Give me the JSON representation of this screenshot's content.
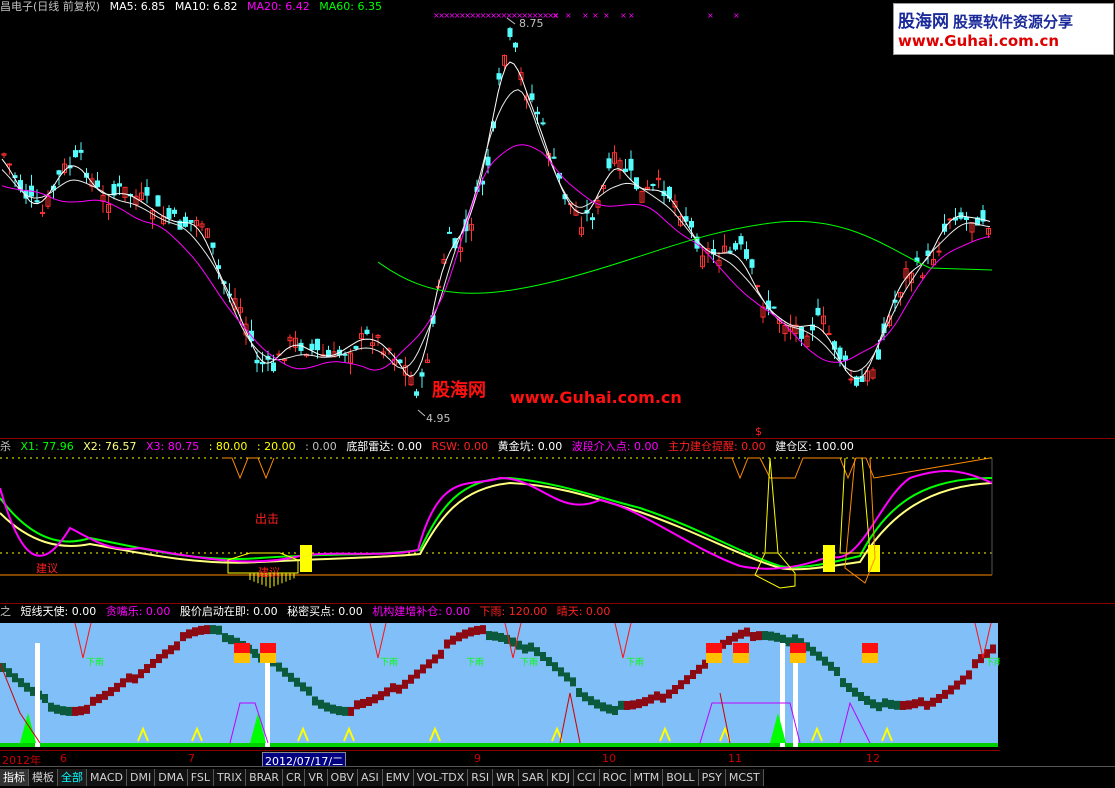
{
  "main_panel": {
    "title": "昌电子(日线 前复权)",
    "ma_items": [
      {
        "label": "MA5: 6.85",
        "color": "#ffffff"
      },
      {
        "label": "MA10: 6.82",
        "color": "#ffffff"
      },
      {
        "label": "MA20: 6.42",
        "color": "#ff00ff"
      },
      {
        "label": "MA60: 6.35",
        "color": "#00ff00"
      }
    ],
    "high_label": "8.75",
    "low_label": "4.95",
    "watermark1": "股海网",
    "watermark2": "www.Guhai.com.cn"
  },
  "logo": {
    "line1a": "股海网",
    "line1b": "股票软件资源分享",
    "line2": "www.Guhai.com.cn"
  },
  "mid_panel": {
    "items": [
      {
        "label": "杀",
        "color": "#c0c0c0"
      },
      {
        "label": "X1: 77.96",
        "color": "#00ff00"
      },
      {
        "label": "X2: 76.57",
        "color": "#ffff80"
      },
      {
        "label": "X3: 80.75",
        "color": "#ff00ff"
      },
      {
        "label": ": 80.00",
        "color": "#ffff00"
      },
      {
        "label": ": 20.00",
        "color": "#ffff00"
      },
      {
        "label": ": 0.00",
        "color": "#c0c0c0"
      },
      {
        "label": "底部雷达: 0.00",
        "color": "#ffffff"
      },
      {
        "label": "RSW: 0.00",
        "color": "#ff2020"
      },
      {
        "label": "黄金坑: 0.00",
        "color": "#ffffff"
      },
      {
        "label": "波段介入点: 0.00",
        "color": "#ff00ff"
      },
      {
        "label": "主力建仓提醒: 0.00",
        "color": "#ff2020"
      },
      {
        "label": "建仓区: 100.00",
        "color": "#ffffff"
      }
    ],
    "text_chuji": "出击",
    "text_jianyi": "建议",
    "text_dollar": "$"
  },
  "low_panel": {
    "items": [
      {
        "label": "之",
        "color": "#c0c0c0"
      },
      {
        "label": "短线天使: 0.00",
        "color": "#ffffff"
      },
      {
        "label": "贪嘴乐: 0.00",
        "color": "#ff00ff"
      },
      {
        "label": "股价启动在即: 0.00",
        "color": "#ffffff"
      },
      {
        "label": "秘密买点: 0.00",
        "color": "#ffffff"
      },
      {
        "label": "机构建增补仓: 0.00",
        "color": "#ff00ff"
      },
      {
        "label": "下雨: 120.00",
        "color": "#ff2020"
      },
      {
        "label": "晴天: 0.00",
        "color": "#ff2020"
      }
    ],
    "rain_label": "下雨"
  },
  "date_axis": {
    "ticks": [
      {
        "label": "2012年"
      },
      {
        "label": "6"
      },
      {
        "label": "7"
      },
      {
        "label": "8"
      },
      {
        "label": "9"
      },
      {
        "label": "10"
      },
      {
        "label": "11"
      },
      {
        "label": "12"
      }
    ],
    "cursor": "2012/07/17/二"
  },
  "tabs": [
    "指标",
    "模板",
    "全部",
    "MACD",
    "DMI",
    "DMA",
    "FSL",
    "TRIX",
    "BRAR",
    "CR",
    "VR",
    "OBV",
    "ASI",
    "EMV",
    "VOL-TDX",
    "RSI",
    "WR",
    "SAR",
    "KDJ",
    "CCI",
    "ROC",
    "MTM",
    "BOLL",
    "PSY",
    "MCST"
  ],
  "colors": {
    "up": "#ff3030",
    "down": "#54fcfc",
    "ma5": "#ffffff",
    "ma20": "#ff00ff",
    "ma60": "#00ff00",
    "panel_bg": "#7fbfff"
  }
}
